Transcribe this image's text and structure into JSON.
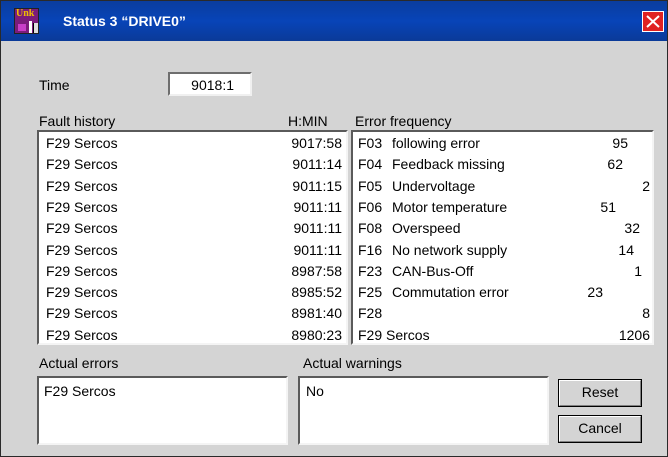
{
  "window": {
    "title": "Status 3 “DRIVE0”",
    "icon_text": "Unk"
  },
  "time": {
    "label": "Time",
    "value": "9018:1"
  },
  "fault_history": {
    "label": "Fault history",
    "time_label": "H:MIN",
    "rows": [
      {
        "name": "F29 Sercos",
        "time": "9017:58"
      },
      {
        "name": "F29 Sercos",
        "time": "9011:14"
      },
      {
        "name": "F29 Sercos",
        "time": "9011:15"
      },
      {
        "name": "F29 Sercos",
        "time": "9011:11"
      },
      {
        "name": "F29 Sercos",
        "time": "9011:11"
      },
      {
        "name": "F29 Sercos",
        "time": "9011:11"
      },
      {
        "name": "F29 Sercos",
        "time": "8987:58"
      },
      {
        "name": "F29 Sercos",
        "time": "8985:52"
      },
      {
        "name": "F29 Sercos",
        "time": "8981:40"
      },
      {
        "name": "F29 Sercos",
        "time": "8980:23"
      }
    ]
  },
  "error_frequency": {
    "label": "Error frequency",
    "rows": [
      {
        "code": "F03",
        "desc": "following error",
        "count": "95"
      },
      {
        "code": "F04",
        "desc": "Feedback missing",
        "count": "62"
      },
      {
        "code": "F05",
        "desc": "Undervoltage",
        "count": "2"
      },
      {
        "code": "F06",
        "desc": "Motor temperature",
        "count": "51"
      },
      {
        "code": "F08",
        "desc": "Overspeed",
        "count": "32"
      },
      {
        "code": "F16",
        "desc": "No network supply",
        "count": "14"
      },
      {
        "code": "F23",
        "desc": "CAN-Bus-Off",
        "count": "1"
      },
      {
        "code": "F25",
        "desc": "Commutation error",
        "count": "23"
      },
      {
        "code": "F28",
        "desc": "",
        "count": "8"
      },
      {
        "code": "F29 Sercos",
        "desc": "",
        "count": "1206"
      }
    ]
  },
  "actual_errors": {
    "label": "Actual errors",
    "value": "F29 Sercos"
  },
  "actual_warnings": {
    "label": "Actual warnings",
    "value": "No"
  },
  "buttons": {
    "reset": "Reset",
    "cancel": "Cancel"
  },
  "colors": {
    "titlebar": "#0844b8",
    "close": "#e02222",
    "dialog_bg": "#d4d4d4"
  }
}
